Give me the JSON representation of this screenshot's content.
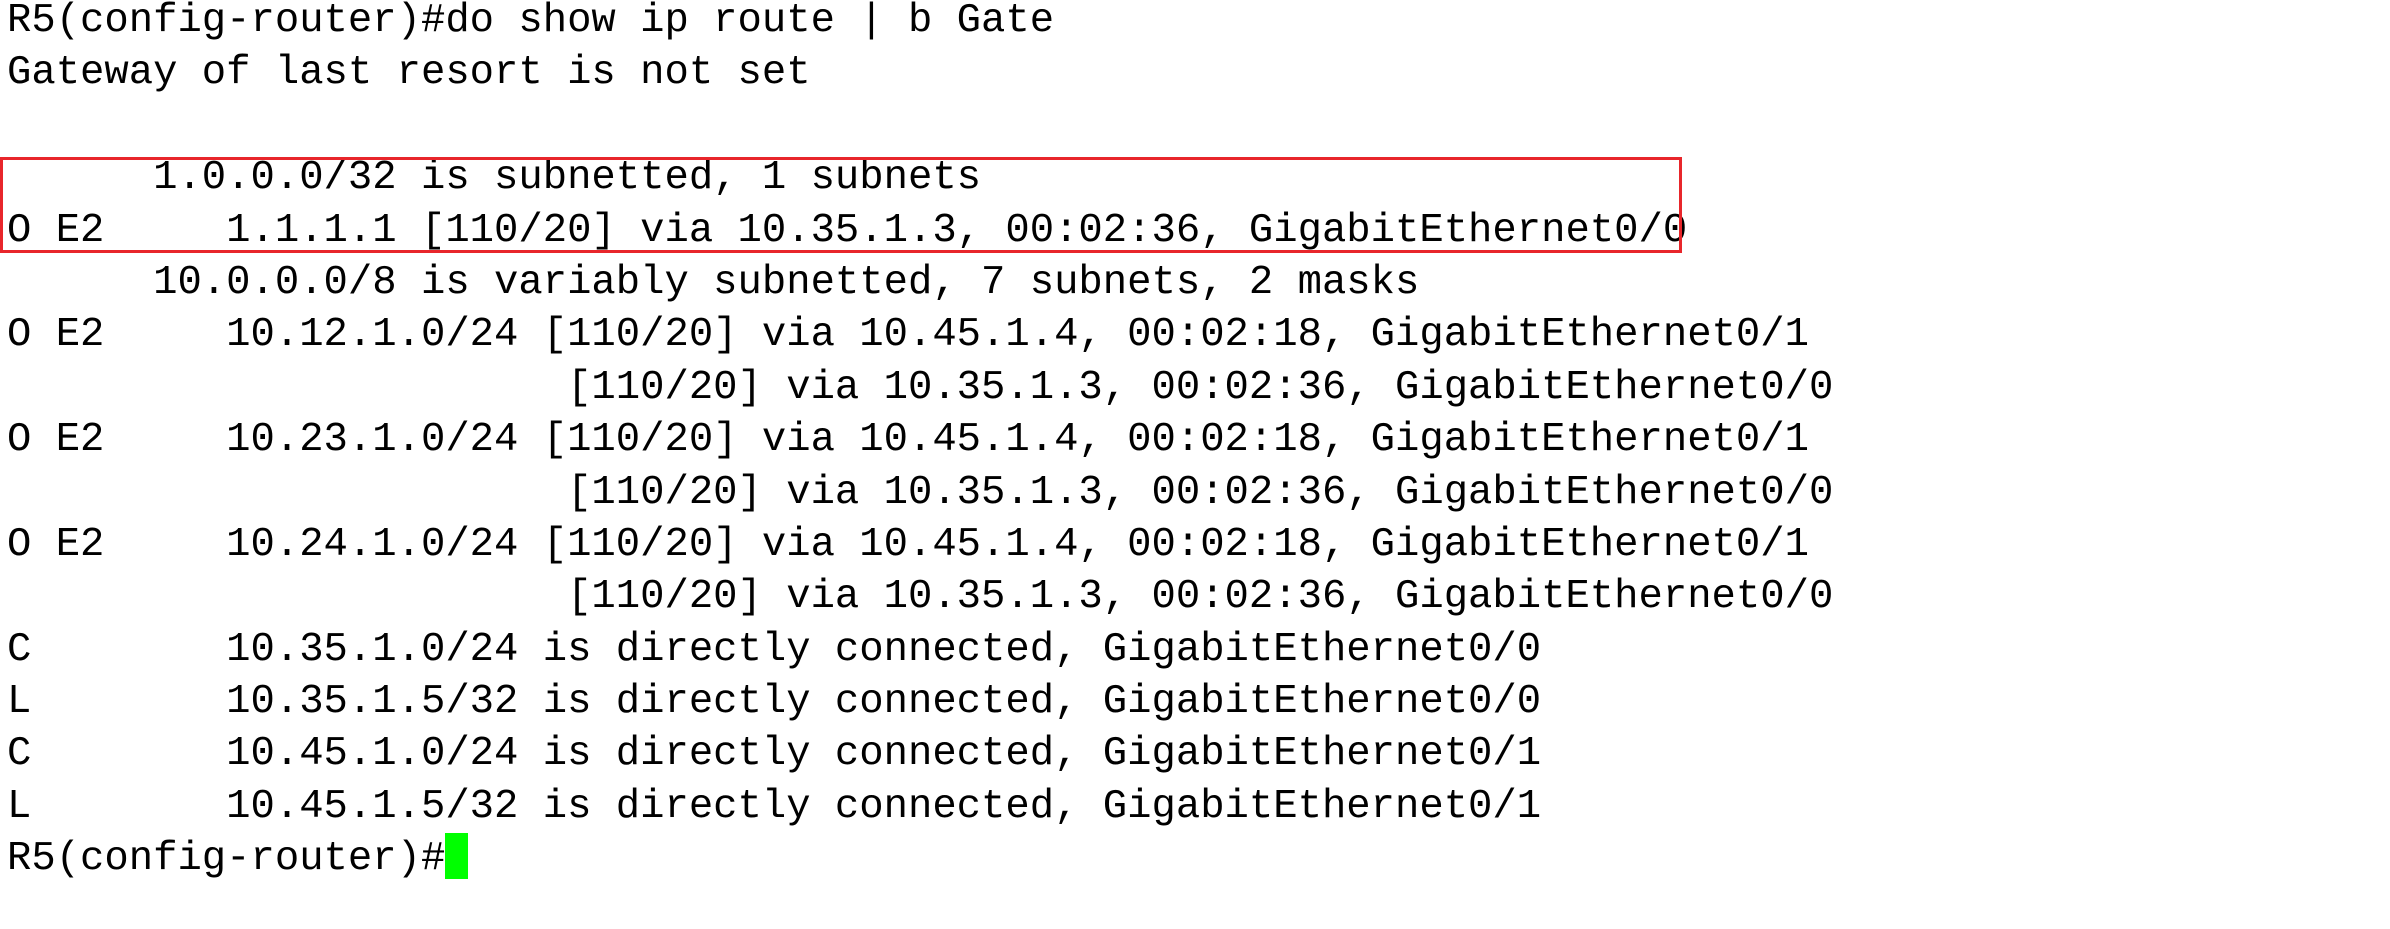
{
  "terminal": {
    "lines": [
      "R5(config-router)#do show ip route | b Gate",
      "Gateway of last resort is not set",
      "",
      "      1.0.0.0/32 is subnetted, 1 subnets",
      "O E2     1.1.1.1 [110/20] via 10.35.1.3, 00:02:36, GigabitEthernet0/0",
      "      10.0.0.0/8 is variably subnetted, 7 subnets, 2 masks",
      "O E2     10.12.1.0/24 [110/20] via 10.45.1.4, 00:02:18, GigabitEthernet0/1",
      "                       [110/20] via 10.35.1.3, 00:02:36, GigabitEthernet0/0",
      "O E2     10.23.1.0/24 [110/20] via 10.45.1.4, 00:02:18, GigabitEthernet0/1",
      "                       [110/20] via 10.35.1.3, 00:02:36, GigabitEthernet0/0",
      "O E2     10.24.1.0/24 [110/20] via 10.45.1.4, 00:02:18, GigabitEthernet0/1",
      "                       [110/20] via 10.35.1.3, 00:02:36, GigabitEthernet0/0",
      "C        10.35.1.0/24 is directly connected, GigabitEthernet0/0",
      "L        10.35.1.5/32 is directly connected, GigabitEthernet0/0",
      "C        10.45.1.0/24 is directly connected, GigabitEthernet0/1",
      "L        10.45.1.5/32 is directly connected, GigabitEthernet0/1"
    ],
    "prompt": "R5(config-router)#",
    "colors": {
      "cursor": "#00ff00",
      "highlight_box": "#e8262b",
      "text": "#000000",
      "background": "#ffffff"
    }
  }
}
